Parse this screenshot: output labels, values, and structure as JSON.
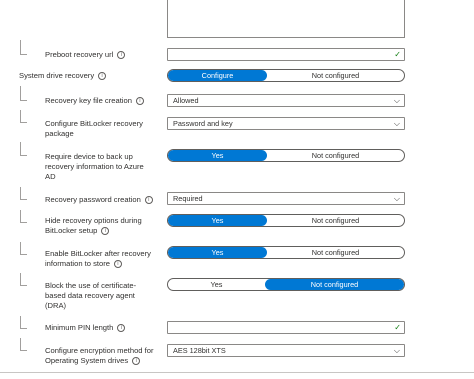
{
  "settings": {
    "preboot_recovery_url": {
      "label": "Preboot recovery url",
      "value": ""
    },
    "system_drive_recovery": {
      "label": "System drive recovery",
      "options": [
        "Configure",
        "Not configured"
      ],
      "selected": "Configure"
    },
    "recovery_key_file_creation": {
      "label": "Recovery key file creation",
      "value": "Allowed"
    },
    "configure_bitlocker_recovery_package": {
      "label_line1": "Configure BitLocker recovery",
      "label_line2": "package",
      "value": "Password and key"
    },
    "require_backup_azure_ad": {
      "label_line1": "Require device to back up",
      "label_line2": "recovery information to Azure",
      "label_line3": "AD",
      "options": [
        "Yes",
        "Not configured"
      ],
      "selected": "Yes"
    },
    "recovery_password_creation": {
      "label": "Recovery password creation",
      "value": "Required"
    },
    "hide_recovery_options": {
      "label_line1": "Hide recovery options during",
      "label_line2": "BitLocker setup",
      "options": [
        "Yes",
        "Not configured"
      ],
      "selected": "Yes"
    },
    "enable_bitlocker_after_recovery": {
      "label_line1": "Enable BitLocker after recovery",
      "label_line2": "information to store",
      "options": [
        "Yes",
        "Not configured"
      ],
      "selected": "Yes"
    },
    "block_certificate_dra": {
      "label_line1": "Block the use of certificate-",
      "label_line2": "based data recovery agent",
      "label_line3": "(DRA)",
      "options": [
        "Yes",
        "Not configured"
      ],
      "selected": "Not configured"
    },
    "minimum_pin_length": {
      "label": "Minimum PIN length",
      "value": ""
    },
    "encryption_method_os": {
      "label_line1": "Configure encryption method for",
      "label_line2": "Operating System drives",
      "value": "AES 128bit XTS"
    }
  },
  "icons": {
    "info": "i",
    "check": "✓",
    "chevron": "⌵"
  }
}
